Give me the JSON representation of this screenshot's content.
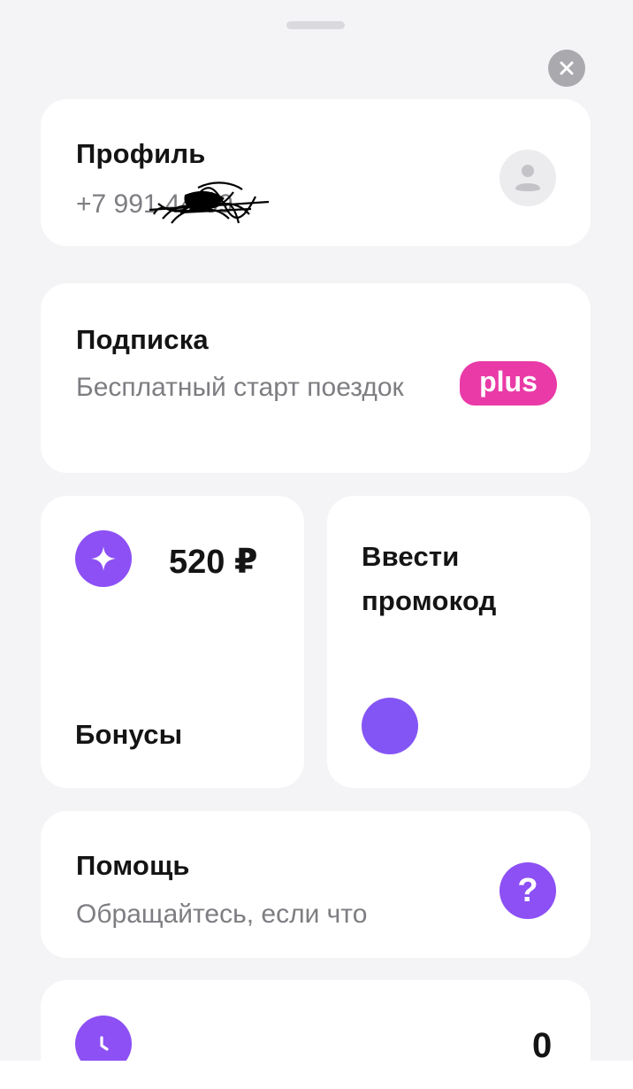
{
  "profile": {
    "title": "Профиль",
    "phone": "+7 991      44-09"
  },
  "subscription": {
    "title": "Подписка",
    "subtitle": "Бесплатный старт поездок",
    "badge": "plus"
  },
  "bonuses": {
    "amount": "520 ₽",
    "title": "Бонусы"
  },
  "promo": {
    "title": "Ввести промокод"
  },
  "help": {
    "title": "Помощь",
    "subtitle": "Обращайтесь, если что"
  },
  "history": {
    "count": "0"
  },
  "icons": {
    "close": "close-icon",
    "avatar": "user-icon",
    "bonus": "sparkle-icon",
    "help": "question-icon",
    "history": "clock-icon"
  },
  "colors": {
    "accent": "#8c50f4",
    "plus_badge": "#e93aa7",
    "card": "#ffffff",
    "background": "#f4f4f7"
  }
}
